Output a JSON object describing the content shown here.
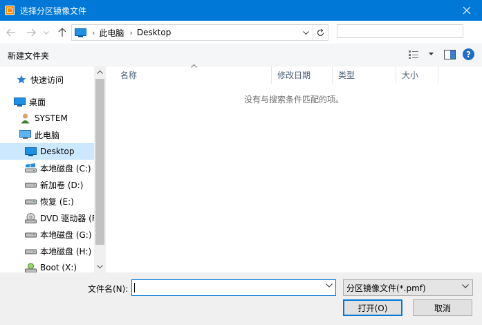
{
  "window": {
    "title": "选择分区镜像文件",
    "accent": "#0078d7"
  },
  "nav": {
    "breadcrumb": [
      "此电脑",
      "Desktop"
    ],
    "search_value": ""
  },
  "toolbar": {
    "new_folder": "新建文件夹",
    "help": "?"
  },
  "sidebar": {
    "items": [
      {
        "label": "快速访问",
        "icon": "star-icon"
      },
      {
        "label": "桌面",
        "icon": "desktop-icon"
      },
      {
        "label": "SYSTEM",
        "icon": "user-icon"
      },
      {
        "label": "此电脑",
        "icon": "computer-icon"
      },
      {
        "label": "Desktop",
        "icon": "desktop-icon",
        "selected": true
      },
      {
        "label": "本地磁盘 (C:)",
        "icon": "system-drive-icon"
      },
      {
        "label": "新加卷 (D:)",
        "icon": "drive-icon"
      },
      {
        "label": "恢复 (E:)",
        "icon": "drive-icon"
      },
      {
        "label": "DVD 驱动器 (F",
        "icon": "dvd-icon"
      },
      {
        "label": "本地磁盘 (G:)",
        "icon": "drive-icon"
      },
      {
        "label": "本地磁盘 (H:)",
        "icon": "drive-icon"
      },
      {
        "label": "Boot (X:)",
        "icon": "boot-drive-icon"
      }
    ]
  },
  "filelist": {
    "columns": [
      "名称",
      "修改日期",
      "类型",
      "大小"
    ],
    "empty_message": "没有与搜索条件匹配的项。"
  },
  "footer": {
    "filename_label": "文件名(N):",
    "filename_value": "",
    "filter": "分区镜像文件(*.pmf)",
    "open": "打开(O)",
    "cancel": "取消"
  }
}
